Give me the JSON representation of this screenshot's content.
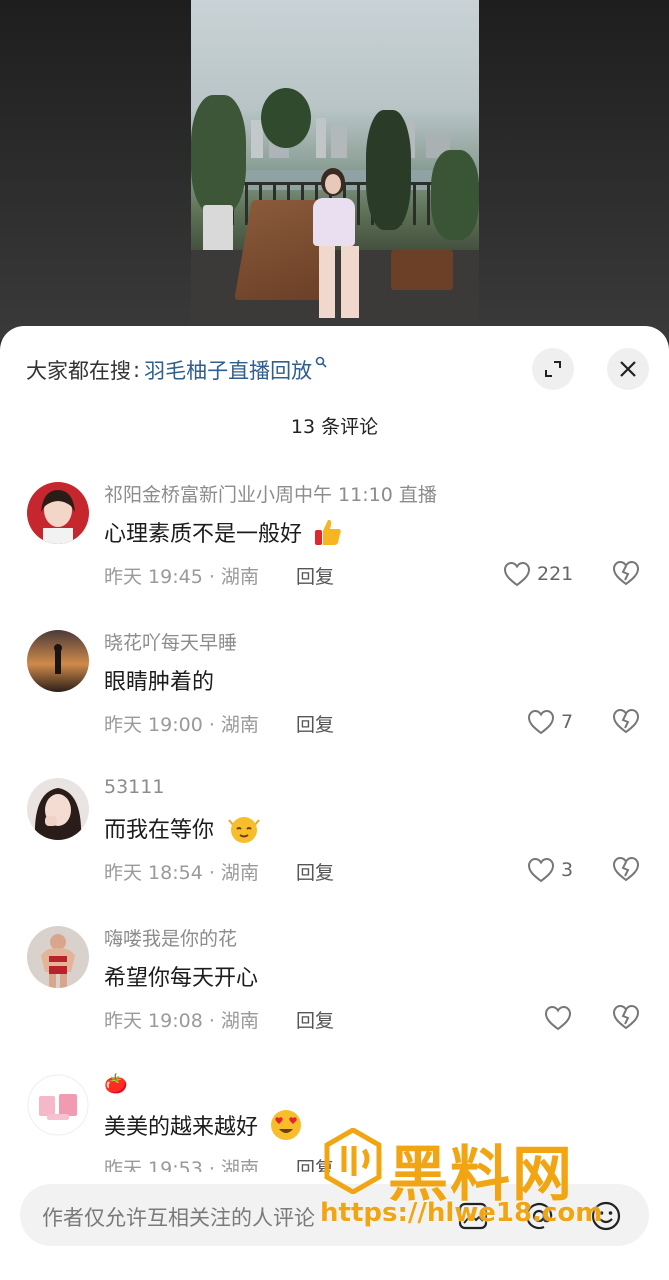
{
  "search": {
    "prefix": "大家都在搜",
    "colon": ":",
    "term": "羽毛柚子直播回放",
    "term_icon": "search-mini-icon"
  },
  "header": {
    "comment_count": "13 条评论",
    "expand_icon": "expand-icon",
    "close_icon": "close-icon"
  },
  "comments": [
    {
      "username": "祁阳金桥富新门业小周中午 11:10 直播",
      "text": "心理素质不是一般好",
      "emoji": "thumbs-up",
      "meta": "昨天 19:45 · 湖南",
      "reply": "回复",
      "likes": "221"
    },
    {
      "username": "晓花吖每天早睡",
      "text": "眼睛肿着的",
      "meta": "昨天 19:00 · 湖南",
      "reply": "回复",
      "likes": "7"
    },
    {
      "username": "53111",
      "text": "而我在等你",
      "emoji": "face",
      "meta": "昨天 18:54 · 湖南",
      "reply": "回复",
      "likes": "3"
    },
    {
      "username": "嗨喽我是你的花",
      "text": "希望你每天开心",
      "meta": "昨天 19:08 · 湖南",
      "reply": "回复",
      "likes": ""
    },
    {
      "username": "🍅",
      "text": "美美的越来越好",
      "emoji": "heart-eyes",
      "meta": "昨天 19:53 · 湖南",
      "reply": "回复",
      "likes": ""
    }
  ],
  "input": {
    "placeholder": "作者仅允许互相关注的人评论"
  },
  "watermark": {
    "brand": "黑料网",
    "url": "https://hlwe18.com"
  },
  "colors": {
    "link": "#2f5e8f",
    "watermark": "#f2a512",
    "like_heart": "#777777"
  }
}
